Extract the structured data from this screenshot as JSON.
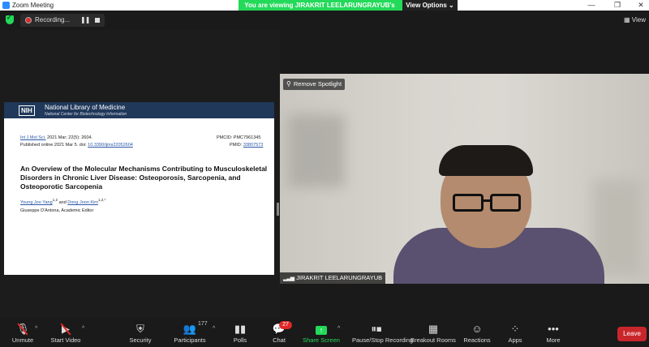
{
  "window": {
    "title": "Zoom Meeting",
    "viewing_banner": "You are viewing JIRAKRIT LEELARUNGRAYUB's screen",
    "view_options": "View Options",
    "view_options_caret": "⌄",
    "controls": {
      "minimize": "—",
      "maximize": "❐",
      "close": "✕"
    }
  },
  "topbar": {
    "recording_label": "Recording...",
    "pause_glyph": "❚❚",
    "view_button": "View",
    "view_icon": "▦"
  },
  "document": {
    "brand": "NIH",
    "org_name": "National Library of Medicine",
    "org_sub": "National Center for Biotechnology Information",
    "journal_ref": "Int J Mol Sci.",
    "journal_rest": " 2021 Mar; 22(5): 2604.",
    "published": "Published online 2021 Mar 5. doi: ",
    "doi": "10.3390/ijms22052604",
    "pmcid": "PMCID: PMC7961345",
    "pmid_label": "PMID: ",
    "pmid": "33807573",
    "title": "An Overview of the Molecular Mechanisms Contributing to Musculoskeletal Disorders in Chronic Liver Disease: Osteoporosis, Sarcopenia, and Osteoporotic Sarcopenia",
    "author1": "Young Joo Yang",
    "author1_sup": "1,2",
    "author_and": " and ",
    "author2": "Dong Joon Kim",
    "author2_sup": "1,2,*",
    "editor": "Giuseppe D'Antona, Academic Editor"
  },
  "video": {
    "spotlight_icon": "⚲",
    "remove_spotlight": "Remove Spotlight",
    "signal_glyph": "▂▃▅",
    "participant_name": "JIRAKRIT LEELARUNGRAYUB"
  },
  "toolbar": {
    "caret": "^",
    "unmute": "Unmute",
    "start_video": "Start Video",
    "security": "Security",
    "participants": "Participants",
    "participants_count": "177",
    "polls": "Polls",
    "chat": "Chat",
    "chat_badge": "27",
    "share_screen": "Share Screen",
    "share_glyph": "↑",
    "pause_stop_recording": "Pause/Stop Recording",
    "breakout_rooms": "Breakout Rooms",
    "reactions": "Reactions",
    "apps": "Apps",
    "more": "More",
    "more_glyph": "•••",
    "leave": "Leave"
  },
  "colors": {
    "accent_green": "#23d959",
    "leave_red": "#c9262c",
    "muted_red": "#e02828",
    "nih_blue": "#20385a"
  }
}
